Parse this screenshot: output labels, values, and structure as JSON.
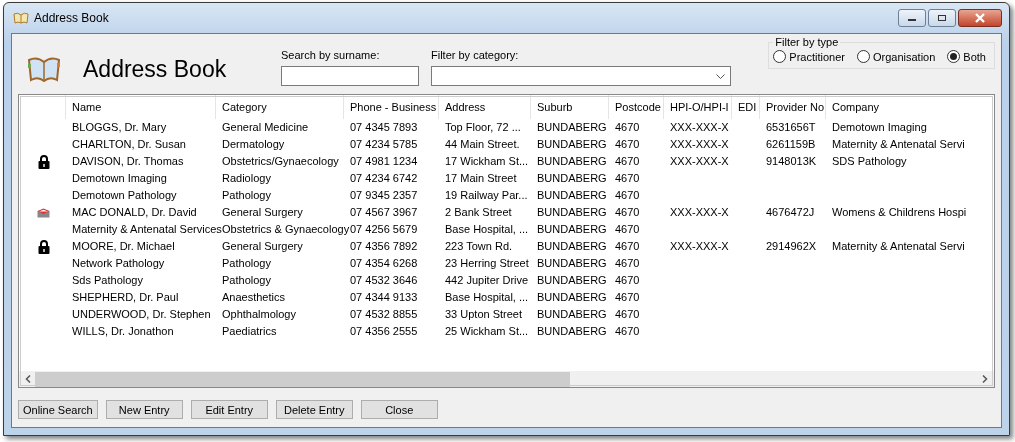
{
  "window": {
    "title": "Address Book"
  },
  "header": {
    "title": "Address Book"
  },
  "search": {
    "label": "Search by surname:"
  },
  "category_filter": {
    "label": "Filter by category:"
  },
  "type_filter": {
    "label": "Filter by type",
    "options": [
      {
        "label": "Practitioner",
        "selected": false
      },
      {
        "label": "Organisation",
        "selected": false
      },
      {
        "label": "Both",
        "selected": true
      }
    ]
  },
  "table": {
    "columns": [
      "Name",
      "Category",
      "Phone - Business",
      "Address",
      "Suburb",
      "Postcode",
      "HPI-O/HPI-I",
      "EDI",
      "Provider No",
      "Company"
    ],
    "rows": [
      {
        "kind": "plain",
        "cells": [
          "BLOGGS, Dr. Mary",
          "General Medicine",
          "07 4345 7893",
          "Top Floor, 72 ...",
          "BUNDABERG",
          "4670",
          "XXX-XXX-X",
          "",
          "6531656T",
          "Demotown Imaging"
        ]
      },
      {
        "kind": "plain",
        "cells": [
          "CHARLTON, Dr. Susan",
          "Dermatology",
          "07 4234 5785",
          "44 Main Street.",
          "BUNDABERG",
          "4670",
          "XXX-XXX-X",
          "",
          "6261159B",
          "Maternity & Antenatal Servi"
        ]
      },
      {
        "kind": "locked",
        "cells": [
          "DAVISON, Dr. Thomas",
          "Obstetrics/Gynaecology",
          "07 4981 1234",
          "17 Wickham St...",
          "BUNDABERG",
          "4670",
          "XXX-XXX-X",
          "",
          "9148013K",
          "SDS Pathology"
        ]
      },
      {
        "kind": "plain",
        "cells": [
          "Demotown Imaging",
          "Radiology",
          "07 4234 6742",
          "17 Main Street",
          "BUNDABERG",
          "4670",
          "",
          "",
          "",
          ""
        ]
      },
      {
        "kind": "plain",
        "cells": [
          "Demotown Pathology",
          "Pathology",
          "07 9345 2357",
          "19 Railway Par...",
          "BUNDABERG",
          "4670",
          "",
          "",
          "",
          ""
        ]
      },
      {
        "kind": "message",
        "cells": [
          "MAC DONALD, Dr. David",
          "General Surgery",
          "07 4567 3967",
          "2 Bank Street",
          "BUNDABERG",
          "4670",
          "XXX-XXX-X",
          "",
          "4676472J",
          "Womens & Childrens Hospi"
        ]
      },
      {
        "kind": "plain",
        "cells": [
          "Maternity & Antenatal Services",
          "Obstetrics & Gynaecology",
          "07 4256 5679",
          "Base Hospital, ...",
          "BUNDABERG",
          "4670",
          "",
          "",
          "",
          ""
        ]
      },
      {
        "kind": "locked",
        "cells": [
          "MOORE, Dr. Michael",
          "General Surgery",
          "07 4356 7892",
          "223 Town Rd.",
          "BUNDABERG",
          "4670",
          "XXX-XXX-X",
          "",
          "2914962X",
          "Maternity & Antenatal Servi"
        ]
      },
      {
        "kind": "plain",
        "cells": [
          "Network Pathology",
          "Pathology",
          "07 4354 6268",
          "23 Herring Street",
          "BUNDABERG",
          "4670",
          "",
          "",
          "",
          ""
        ]
      },
      {
        "kind": "plain",
        "cells": [
          "Sds Pathology",
          "Pathology",
          "07 4532 3646",
          "442 Jupiter Drive",
          "BUNDABERG",
          "4670",
          "",
          "",
          "",
          ""
        ]
      },
      {
        "kind": "plain",
        "cells": [
          "SHEPHERD, Dr. Paul",
          "Anaesthetics",
          "07 4344 9133",
          "Base Hospital, ...",
          "BUNDABERG",
          "4670",
          "",
          "",
          "",
          ""
        ]
      },
      {
        "kind": "plain",
        "cells": [
          "UNDERWOOD, Dr. Stephen",
          "Ophthalmology",
          "07 4532 8855",
          "33 Upton Street",
          "BUNDABERG",
          "4670",
          "",
          "",
          "",
          ""
        ]
      },
      {
        "kind": "plain",
        "cells": [
          "WILLS, Dr. Jonathon",
          "Paediatrics",
          "07 4356 2555",
          "25 Wickham St...",
          "BUNDABERG",
          "4670",
          "",
          "",
          "",
          ""
        ]
      }
    ]
  },
  "buttons": [
    "Online Search",
    "New Entry",
    "Edit Entry",
    "Delete Entry",
    "Close"
  ]
}
